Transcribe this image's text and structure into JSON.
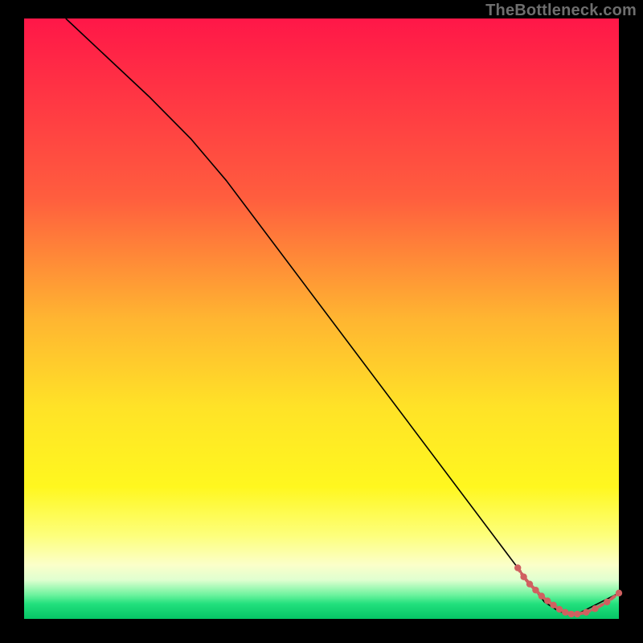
{
  "watermark": "TheBottleneck.com",
  "chart_data": {
    "type": "line",
    "title": "",
    "xlabel": "",
    "ylabel": "",
    "xlim": [
      0,
      100
    ],
    "ylim": [
      0,
      100
    ],
    "gradient_stops": [
      {
        "offset": 0.0,
        "color": "#ff1748"
      },
      {
        "offset": 0.3,
        "color": "#ff5e3e"
      },
      {
        "offset": 0.5,
        "color": "#ffb531"
      },
      {
        "offset": 0.65,
        "color": "#ffe327"
      },
      {
        "offset": 0.78,
        "color": "#fff71f"
      },
      {
        "offset": 0.86,
        "color": "#fdff7a"
      },
      {
        "offset": 0.91,
        "color": "#fbffc9"
      },
      {
        "offset": 0.935,
        "color": "#e0ffd0"
      },
      {
        "offset": 0.96,
        "color": "#6df39e"
      },
      {
        "offset": 0.975,
        "color": "#22e07d"
      },
      {
        "offset": 1.0,
        "color": "#06c566"
      }
    ],
    "series": [
      {
        "name": "curve",
        "stroke": "#000000",
        "stroke_width": 1.6,
        "x": [
          7.0,
          21.0,
          28.0,
          34.0,
          83.0,
          87.5,
          90.0,
          93.0,
          100.0
        ],
        "y": [
          100.0,
          87.0,
          80.0,
          73.0,
          8.5,
          2.8,
          1.2,
          0.8,
          4.3
        ]
      },
      {
        "name": "markers",
        "stroke": "#d06060",
        "marker_color": "#d06060",
        "marker_radius": 4.2,
        "stroke_width": 4.0,
        "x": [
          83.0,
          84.0,
          85.0,
          86.0,
          87.0,
          88.0,
          89.0,
          90.0,
          91.0,
          92.0,
          93.0,
          94.5,
          96.0,
          98.0,
          100.0
        ],
        "y": [
          8.5,
          7.0,
          5.8,
          4.8,
          3.8,
          3.0,
          2.3,
          1.6,
          1.1,
          0.8,
          0.8,
          1.1,
          1.7,
          2.8,
          4.3
        ]
      }
    ]
  }
}
